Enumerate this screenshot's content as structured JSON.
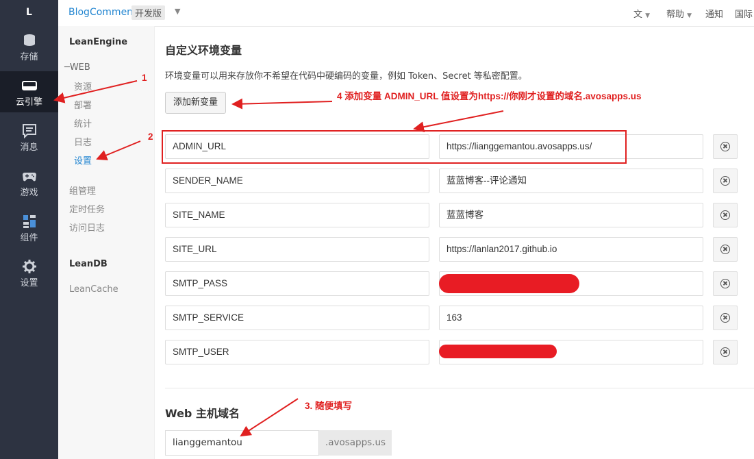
{
  "rail": {
    "logo": "L",
    "items": [
      {
        "label": "存储",
        "icon": "database-icon"
      },
      {
        "label": "云引擎",
        "icon": "server-icon"
      },
      {
        "label": "消息",
        "icon": "message-icon"
      },
      {
        "label": "游戏",
        "icon": "gamepad-icon"
      },
      {
        "label": "组件",
        "icon": "puzzle-icon"
      },
      {
        "label": "设置",
        "icon": "gear-icon"
      }
    ]
  },
  "topbar": {
    "app_name": "BlogComment",
    "env": "开发版",
    "menu": [
      "文",
      "帮助",
      "通知",
      "国际"
    ]
  },
  "subnav": {
    "leanengine": "LeanEngine",
    "web": "WEB",
    "web_children": [
      "资源",
      "部署",
      "统计",
      "日志",
      "设置"
    ],
    "items": [
      "组管理",
      "定时任务",
      "访问日志"
    ],
    "leandb": "LeanDB",
    "leancache": "LeanCache"
  },
  "main": {
    "title": "自定义环境变量",
    "description": "环境变量可以用来存放你不希望在代码中硬编码的变量，例如 Token、Secret 等私密配置。",
    "add_button": "添加新变量",
    "env_vars": [
      {
        "key": "ADMIN_URL",
        "value": "https://lianggemantou.avosapps.us/"
      },
      {
        "key": "SENDER_NAME",
        "value": "蓝蓝博客--评论通知"
      },
      {
        "key": "SITE_NAME",
        "value": "蓝蓝博客"
      },
      {
        "key": "SITE_URL",
        "value": "https://lanlan2017.github.io"
      },
      {
        "key": "SMTP_PASS",
        "value": ""
      },
      {
        "key": "SMTP_SERVICE",
        "value": "163"
      },
      {
        "key": "SMTP_USER",
        "value": ""
      }
    ],
    "web_host_title": "Web 主机域名",
    "domain_value": "lianggemantou",
    "domain_suffix": ".avosapps.us"
  },
  "annotations": {
    "a1": "1",
    "a2": "2",
    "a3": "3. 随便填写",
    "a4": "4 添加变量 ADMIN_URL 值设置为https://你刚才设置的域名.avosapps.us"
  },
  "colors": {
    "accent": "#2386d1",
    "rail_bg": "#2d3341",
    "annotation": "#e02020"
  }
}
